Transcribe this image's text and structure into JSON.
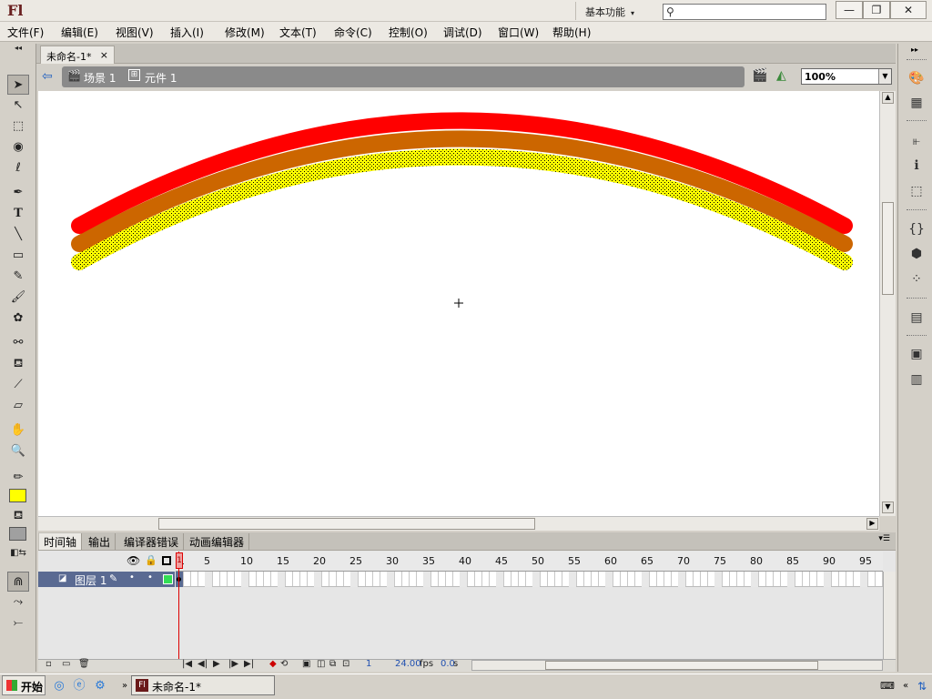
{
  "app": {
    "logo": "Fl",
    "workspace": "基本功能",
    "search_placeholder": "",
    "window_controls": [
      "—",
      "❐",
      "✕"
    ]
  },
  "menu": [
    "文件(F)",
    "编辑(E)",
    "视图(V)",
    "插入(I)",
    "修改(M)",
    "文本(T)",
    "命令(C)",
    "控制(O)",
    "调试(D)",
    "窗口(W)",
    "帮助(H)"
  ],
  "document": {
    "tab_title": "未命名-1*",
    "close": "×"
  },
  "scene_bar": {
    "scene": "场景 1",
    "symbol": "元件 1",
    "zoom": "100%"
  },
  "stage": {
    "arcs": [
      {
        "color": "#ff0000"
      },
      {
        "color": "#cc6600"
      },
      {
        "color": "#ffff00"
      }
    ]
  },
  "timeline": {
    "tabs": [
      "时间轴",
      "输出",
      "编译器错误",
      "动画编辑器"
    ],
    "ruler_labels": [
      "1",
      "5",
      "10",
      "15",
      "20",
      "25",
      "30",
      "35",
      "40",
      "45",
      "50",
      "55",
      "60",
      "65",
      "70",
      "75",
      "80",
      "85",
      "90",
      "95"
    ],
    "layer_name": "图层 1",
    "current_frame": "1",
    "fps": "24.00",
    "fps_unit": "fps",
    "time": "0.0",
    "time_unit": "s"
  },
  "taskbar": {
    "start": "开始",
    "app_title": "未命名-1*",
    "app_icon": "Fl"
  }
}
